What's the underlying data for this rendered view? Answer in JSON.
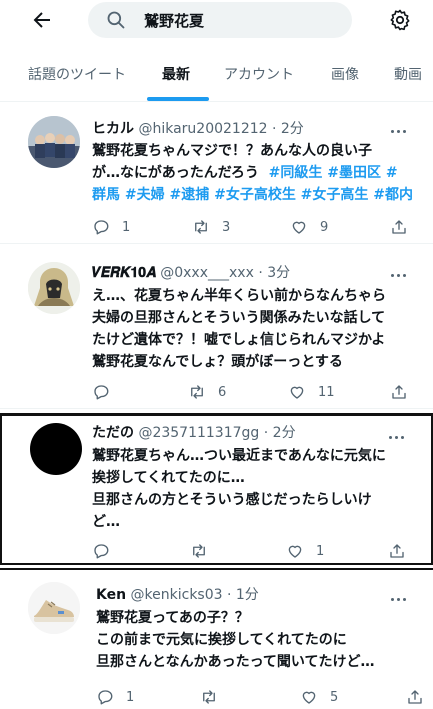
{
  "search": {
    "query": "鷲野花夏"
  },
  "tabs": [
    {
      "label": "話題のツイート"
    },
    {
      "label": "最新"
    },
    {
      "label": "アカウント"
    },
    {
      "label": "画像"
    },
    {
      "label": "動画"
    }
  ],
  "tweets": [
    {
      "name": "ヒカル",
      "handle": "@hikaru20021212",
      "time": "· 2分",
      "lines": [
        "鷲野花夏ちゃんマジで！？あんな人の良い子",
        "が…なにがあったんだろう"
      ],
      "tags_line2": "#同級生 #墨田区 #",
      "tags_line3": "群馬 #夫婦 #逮捕 #女子高校生 #女子高生 #都内",
      "replies": "1",
      "retweets": "3",
      "likes": "9"
    },
    {
      "name": "𝑽𝑬𝑹𝑲𝟏𝟎𝑨",
      "handle": "@0xxx___xxx",
      "time": "· 3分",
      "lines": [
        "え…、花夏ちゃん半年くらい前からなんちゃら",
        "夫婦の旦那さんとそういう関係みたいな話して",
        "たけど遺体で？！嘘でしょ信じられんマジかよ",
        "鷲野花夏なんでしょ？頭がぼーっとする"
      ],
      "replies": "",
      "retweets": "6",
      "likes": "11"
    },
    {
      "name": "ただの",
      "handle": "@2357111317gg",
      "time": "· 2分",
      "lines": [
        "鷲野花夏ちゃん…つい最近まであんなに元気に",
        "挨拶してくれてたのに…",
        "旦那さんの方とそういう感じだったらしいけ",
        "ど…"
      ],
      "replies": "",
      "retweets": "",
      "likes": "1"
    },
    {
      "name": "Ken",
      "handle": "@kenkicks03",
      "time": "· 1分",
      "lines": [
        "鷲野花夏ってあの子？？",
        "この前まで元気に挨拶してくれてたのに",
        "旦那さんとなんかあったって聞いてたけど…"
      ],
      "replies": "1",
      "retweets": "",
      "likes": "5"
    }
  ],
  "colors": {
    "accent": "#1d9bf0",
    "text": "#0f1419",
    "muted": "#536471"
  }
}
